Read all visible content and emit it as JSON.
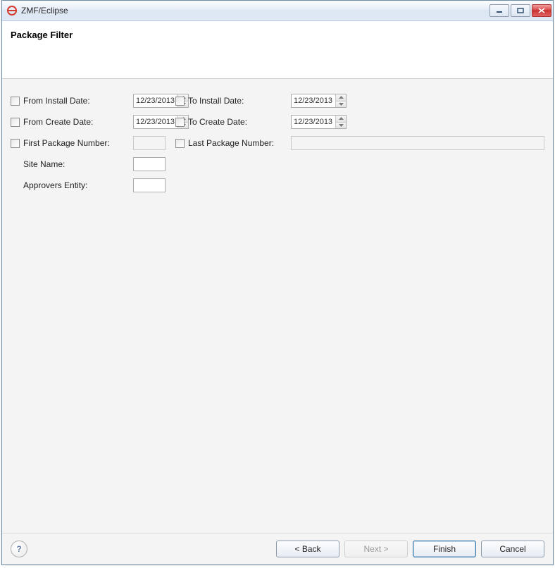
{
  "window": {
    "title": "ZMF/Eclipse"
  },
  "header": {
    "title": "Package Filter"
  },
  "form": {
    "fromInstallDate": {
      "label": "From Install Date:",
      "value": "12/23/2013"
    },
    "toInstallDate": {
      "label": "To Install Date:",
      "value": "12/23/2013"
    },
    "fromCreateDate": {
      "label": "From Create Date:",
      "value": "12/23/2013"
    },
    "toCreateDate": {
      "label": "To Create Date:",
      "value": "12/23/2013"
    },
    "firstPackageNumber": {
      "label": "First Package Number:",
      "value": ""
    },
    "lastPackageNumber": {
      "label": "Last Package Number:",
      "value": ""
    },
    "siteName": {
      "label": "Site Name:",
      "value": ""
    },
    "approversEntity": {
      "label": "Approvers Entity:",
      "value": ""
    }
  },
  "footer": {
    "back": "< Back",
    "next": "Next >",
    "finish": "Finish",
    "cancel": "Cancel"
  }
}
